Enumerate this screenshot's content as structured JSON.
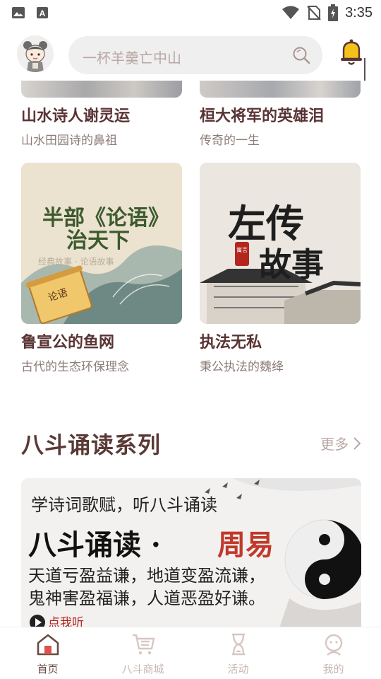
{
  "status_bar": {
    "time": "3:35"
  },
  "header": {
    "search_placeholder": "一杯羊羹亡中山"
  },
  "cards": [
    {
      "title": "山水诗人谢灵运",
      "subtitle": "山水田园诗的鼻祖"
    },
    {
      "title": "桓大将军的英雄泪",
      "subtitle": "传奇的一生"
    },
    {
      "title": "鲁宣公的鱼网",
      "subtitle": "古代的生态环保理念",
      "art_line1": "半部《论语》",
      "art_line2": "治天下",
      "art_caption": "经典故事 · 论语故事",
      "art_scroll": "论语"
    },
    {
      "title": "执法无私",
      "subtitle": "秉公执法的魏绛",
      "art_line1": "左传",
      "art_line2": "故事",
      "art_seal": "寓言"
    }
  ],
  "section": {
    "title": "八斗诵读系列",
    "more_label": "更多"
  },
  "banner": {
    "line1": "学诗词歌赋，听八斗诵读",
    "line2_black": "八斗诵读 · ",
    "line2_red": "周易",
    "line3": "天道亏盈益谦，地道变盈流谦，",
    "line4": "鬼神害盈福谦，人道恶盈好谦。",
    "play_label": "点我听"
  },
  "tabs": [
    {
      "label": "首页",
      "icon": "home-icon",
      "active": true
    },
    {
      "label": "八斗商城",
      "icon": "cart-icon",
      "active": false
    },
    {
      "label": "活动",
      "icon": "hourglass-icon",
      "active": false
    },
    {
      "label": "我的",
      "icon": "profile-icon",
      "active": false
    }
  ],
  "colors": {
    "accent": "#c0392b",
    "title": "#5a3434",
    "tab_inactive": "#c9b7b3",
    "bell": "#e8b40f"
  }
}
